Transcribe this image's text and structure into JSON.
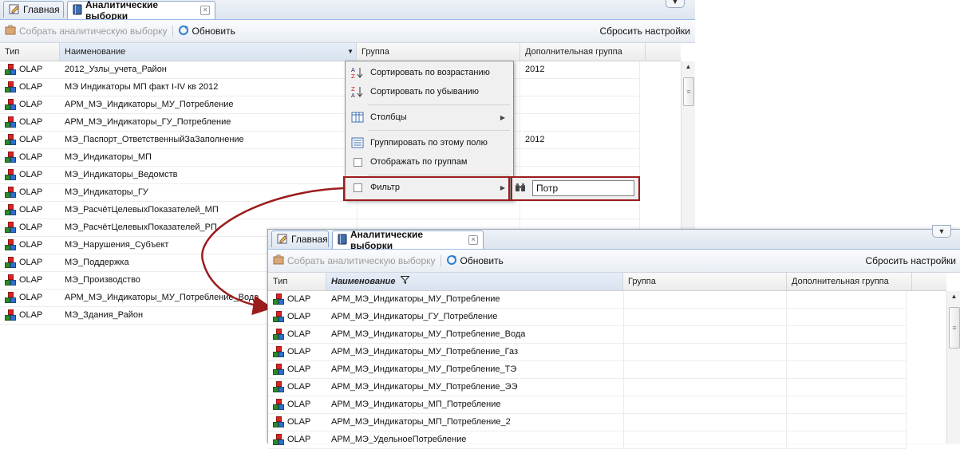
{
  "colors": {
    "accent": "#99bbe8",
    "highlight": "#9b1c1c"
  },
  "panel1": {
    "tabs": [
      {
        "label": "Главная",
        "icon": "home-edit-icon"
      },
      {
        "label": "Аналитические выборки",
        "icon": "book-icon"
      }
    ],
    "toolbar": {
      "collect_label": "Собрать аналитическую выборку",
      "refresh_label": "Обновить",
      "reset_label": "Сбросить настройки"
    },
    "columns": [
      "Тип",
      "Наименование",
      "Группа",
      "Дополнительная группа"
    ],
    "rows": [
      {
        "type": "OLAP",
        "name": "2012_Узлы_учета_Район",
        "group": "",
        "extra": "2012"
      },
      {
        "type": "OLAP",
        "name": "МЭ Индикаторы МП факт I-IV кв 2012",
        "group": "",
        "extra": ""
      },
      {
        "type": "OLAP",
        "name": "АРМ_МЭ_Индикаторы_МУ_Потребление",
        "group": "",
        "extra": ""
      },
      {
        "type": "OLAP",
        "name": "АРМ_МЭ_Индикаторы_ГУ_Потребление",
        "group": "",
        "extra": ""
      },
      {
        "type": "OLAP",
        "name": "МЭ_Паспорт_ОтветственныйЗаЗаполнение",
        "group": "",
        "extra": "2012"
      },
      {
        "type": "OLAP",
        "name": "МЭ_Индикаторы_МП",
        "group": "",
        "extra": ""
      },
      {
        "type": "OLAP",
        "name": "МЭ_Индикаторы_Ведомств",
        "group": "",
        "extra": ""
      },
      {
        "type": "OLAP",
        "name": "МЭ_Индикаторы_ГУ",
        "group": "",
        "extra": ""
      },
      {
        "type": "OLAP",
        "name": "МЭ_РасчётЦелевыхПоказателей_МП",
        "group": "",
        "extra": ""
      },
      {
        "type": "OLAP",
        "name": "МЭ_РасчётЦелевыхПоказателей_РП",
        "group": "",
        "extra": ""
      },
      {
        "type": "OLAP",
        "name": "МЭ_Нарушения_Субъект",
        "group": "",
        "extra": ""
      },
      {
        "type": "OLAP",
        "name": "МЭ_Поддержка",
        "group": "",
        "extra": ""
      },
      {
        "type": "OLAP",
        "name": "МЭ_Производство",
        "group": "",
        "extra": ""
      },
      {
        "type": "OLAP",
        "name": "АРМ_МЭ_Индикаторы_МУ_Потребление_Вода",
        "group": "",
        "extra": ""
      },
      {
        "type": "OLAP",
        "name": "МЭ_Здания_Район",
        "group": "",
        "extra": ""
      }
    ],
    "menu": {
      "sort_asc": "Сортировать по возрастанию",
      "sort_desc": "Сортировать по убыванию",
      "columns": "Столбцы",
      "group_by": "Группировать по этому полю",
      "show_groups": "Отображать по группам",
      "filter": "Фильтр",
      "filter_value": "Потр"
    }
  },
  "panel2": {
    "tabs": [
      {
        "label": "Главная",
        "icon": "home-edit-icon"
      },
      {
        "label": "Аналитические выборки",
        "icon": "book-icon"
      }
    ],
    "toolbar": {
      "collect_label": "Собрать аналитическую выборку",
      "refresh_label": "Обновить",
      "reset_label": "Сбросить настройки"
    },
    "columns": [
      "Тип",
      "Наименование",
      "Группа",
      "Дополнительная группа"
    ],
    "rows": [
      {
        "type": "OLAP",
        "name": "АРМ_МЭ_Индикаторы_МУ_Потребление"
      },
      {
        "type": "OLAP",
        "name": "АРМ_МЭ_Индикаторы_ГУ_Потребление"
      },
      {
        "type": "OLAP",
        "name": "АРМ_МЭ_Индикаторы_МУ_Потребление_Вода"
      },
      {
        "type": "OLAP",
        "name": "АРМ_МЭ_Индикаторы_МУ_Потребление_Газ"
      },
      {
        "type": "OLAP",
        "name": "АРМ_МЭ_Индикаторы_МУ_Потребление_ТЭ"
      },
      {
        "type": "OLAP",
        "name": "АРМ_МЭ_Индикаторы_МУ_Потребление_ЭЭ"
      },
      {
        "type": "OLAP",
        "name": "АРМ_МЭ_Индикаторы_МП_Потребление"
      },
      {
        "type": "OLAP",
        "name": "АРМ_МЭ_Индикаторы_МП_Потребление_2"
      },
      {
        "type": "OLAP",
        "name": "АРМ_МЭ_УдельноеПотребление"
      }
    ]
  }
}
